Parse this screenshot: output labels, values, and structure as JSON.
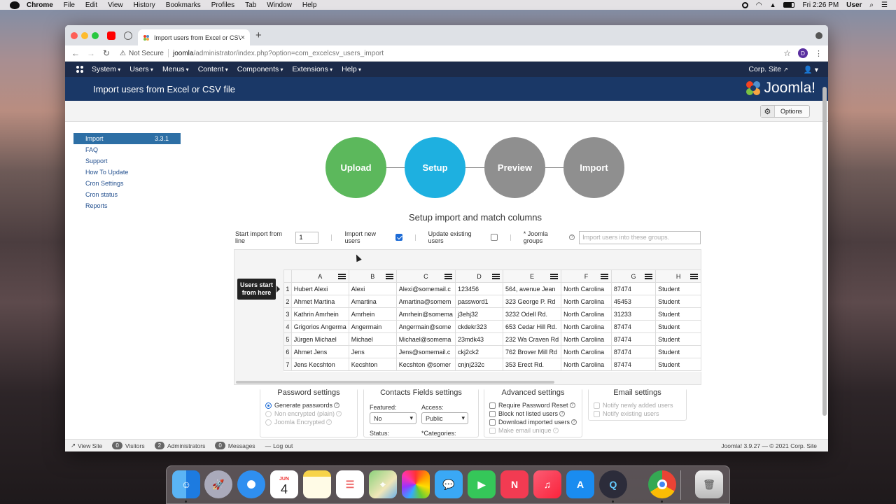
{
  "menubar": {
    "app": "Chrome",
    "items": [
      "File",
      "Edit",
      "View",
      "History",
      "Bookmarks",
      "Profiles",
      "Tab",
      "Window",
      "Help"
    ],
    "clock": "Fri 2:26 PM",
    "user": "User"
  },
  "browser": {
    "tab_title": "Import users from Excel or CSV",
    "security": "Not Secure",
    "url_host": "joomla",
    "url_path": "/administrator/index.php?option=com_excelcsv_users_import",
    "profile_initial": "D"
  },
  "joomla": {
    "nav": [
      "System",
      "Users",
      "Menus",
      "Content",
      "Components",
      "Extensions",
      "Help"
    ],
    "site_link": "Corp. Site",
    "page_title": "Import users from Excel or CSV file",
    "brand": "Joomla!",
    "options_label": "Options"
  },
  "sidebar": {
    "active": {
      "label": "Import",
      "version": "3.3.1"
    },
    "items": [
      "FAQ",
      "Support",
      "How To Update",
      "Cron Settings",
      "Cron status",
      "Reports"
    ]
  },
  "steps": [
    {
      "label": "Upload",
      "color": "#5cb85c"
    },
    {
      "label": "Setup",
      "color": "#1eb0e0"
    },
    {
      "label": "Preview",
      "color": "#8f8f8f"
    },
    {
      "label": "Import",
      "color": "#8f8f8f"
    }
  ],
  "setup": {
    "title": "Setup import and match columns",
    "start_line_label": "Start import from line",
    "start_line_value": "1",
    "import_new_label": "Import new users",
    "import_new_checked": true,
    "update_existing_label": "Update existing users",
    "update_existing_checked": false,
    "groups_label": "* Joomla groups",
    "groups_placeholder": "Import users into these groups."
  },
  "grid": {
    "callout": [
      "Users start",
      "from here"
    ],
    "columns": [
      "A",
      "B",
      "C",
      "D",
      "E",
      "F",
      "G",
      "H"
    ],
    "rows": [
      [
        "1",
        "Hubert Alexi",
        "Alexi",
        "Alexi@somemail.c",
        "123456",
        "564, avenue Jean",
        "North Carolina",
        "87474",
        "Student"
      ],
      [
        "2",
        "Ahmet Martina",
        "Amartina",
        "Amartina@somem",
        "password1",
        "323 George P. Rd",
        "North Carolina",
        "45453",
        "Student"
      ],
      [
        "3",
        "Kathrin Amrhein",
        "Amrhein",
        "Amrhein@somema",
        "j3ehj32",
        "3232 Odell Rd.",
        "North Carolina",
        "31233",
        "Student"
      ],
      [
        "4",
        "Grigorios Angerma",
        "Angermain",
        "Angermain@some",
        "ckdekr323",
        "653 Cedar Hill Rd.",
        "North Carolina",
        "87474",
        "Student"
      ],
      [
        "5",
        "Jürgen Michael",
        "Michael",
        "Michael@somema",
        "23mdk43",
        "232 Wa Craven Rd",
        "North Carolina",
        "87474",
        "Student"
      ],
      [
        "6",
        "Ahmet Jens",
        "Jens",
        "Jens@somemail.c",
        "ckj2ck2",
        "762 Brover Mill Rd",
        "North Carolina",
        "87474",
        "Student"
      ],
      [
        "7",
        "Jens Kecshton",
        "Kecshton",
        "Kecshton @somer",
        "cnjnj232c",
        "353 Erect Rd.",
        "North Carolina",
        "87474",
        "Student"
      ]
    ]
  },
  "password_settings": {
    "title": "Password settings",
    "options": [
      "Generate passwords",
      "Non encrypted (plain)",
      "Joomla Encrypted"
    ]
  },
  "contacts_settings": {
    "title": "Contacts Fields settings",
    "featured_label": "Featured:",
    "featured_value": "No",
    "access_label": "Access:",
    "access_value": "Public",
    "status_label": "Status:",
    "categories_label": "*Categories:"
  },
  "advanced_settings": {
    "title": "Advanced settings",
    "options": [
      "Require Password Reset",
      "Block not listed users",
      "Download imported users",
      "Make email unique"
    ]
  },
  "email_settings": {
    "title": "Email settings",
    "options": [
      "Notify newly added users",
      "Notify existing users"
    ]
  },
  "statusbar": {
    "view_site": "View Site",
    "visitors_count": "0",
    "visitors_label": "Visitors",
    "admins_count": "2",
    "admins_label": "Administrators",
    "messages_count": "0",
    "messages_label": "Messages",
    "logout": "Log out",
    "version": "Joomla! 3.9.27  —  © 2021 Corp. Site"
  },
  "dock": {
    "calendar_month": "JUN",
    "calendar_day": "4"
  }
}
